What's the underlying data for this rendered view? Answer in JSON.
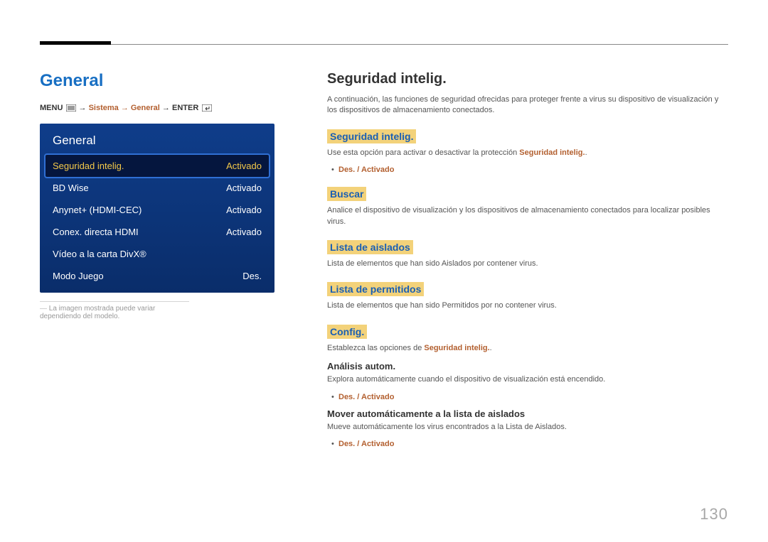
{
  "page_number": "130",
  "left": {
    "title": "General",
    "breadcrumb": {
      "prefix": "MENU",
      "path_pre": " → ",
      "path_accent": "Sistema → General",
      "path_post": " → ",
      "suffix": "ENTER"
    },
    "menu_title": "General",
    "items": [
      {
        "label": "Seguridad intelig.",
        "value": "Activado",
        "selected": true
      },
      {
        "label": "BD Wise",
        "value": "Activado",
        "selected": false
      },
      {
        "label": "Anynet+ (HDMI-CEC)",
        "value": "Activado",
        "selected": false
      },
      {
        "label": "Conex. directa HDMI",
        "value": "Activado",
        "selected": false
      },
      {
        "label": "Vídeo a la carta DivX®",
        "value": "",
        "selected": false
      },
      {
        "label": "Modo Juego",
        "value": "Des.",
        "selected": false
      }
    ],
    "caption": "La imagen mostrada puede variar dependiendo del modelo."
  },
  "right": {
    "h1": "Seguridad intelig.",
    "intro": "A continuación, las funciones de seguridad ofrecidas para proteger frente a virus su dispositivo de visualización y los dispositivos de almacenamiento conectados.",
    "sections": [
      {
        "h2": "Seguridad intelig.",
        "body_pre": "Use esta opción para activar o desactivar la protección ",
        "body_accent": "Seguridad intelig.",
        "body_post": ".",
        "bullet_accent": "Des. / Activado"
      },
      {
        "h2": "Buscar",
        "body": "Analice el dispositivo de visualización y los dispositivos de almacenamiento conectados para localizar posibles virus."
      },
      {
        "h2": "Lista de aislados",
        "body": "Lista de elementos que han sido Aislados por contener virus."
      },
      {
        "h2": "Lista de permitidos",
        "body": "Lista de elementos que han sido Permitidos por no contener virus."
      },
      {
        "h2": "Config.",
        "body_pre": "Establezca las opciones de ",
        "body_accent": "Seguridad intelig.",
        "body_post": ".",
        "subs": [
          {
            "h3": "Análisis autom.",
            "body": "Explora automáticamente cuando el dispositivo de visualización está encendido.",
            "bullet_accent": "Des. / Activado"
          },
          {
            "h3": "Mover automáticamente a la lista de aislados",
            "body": "Mueve automáticamente los virus encontrados a la Lista de Aislados.",
            "bullet_accent": "Des. / Activado"
          }
        ]
      }
    ]
  }
}
